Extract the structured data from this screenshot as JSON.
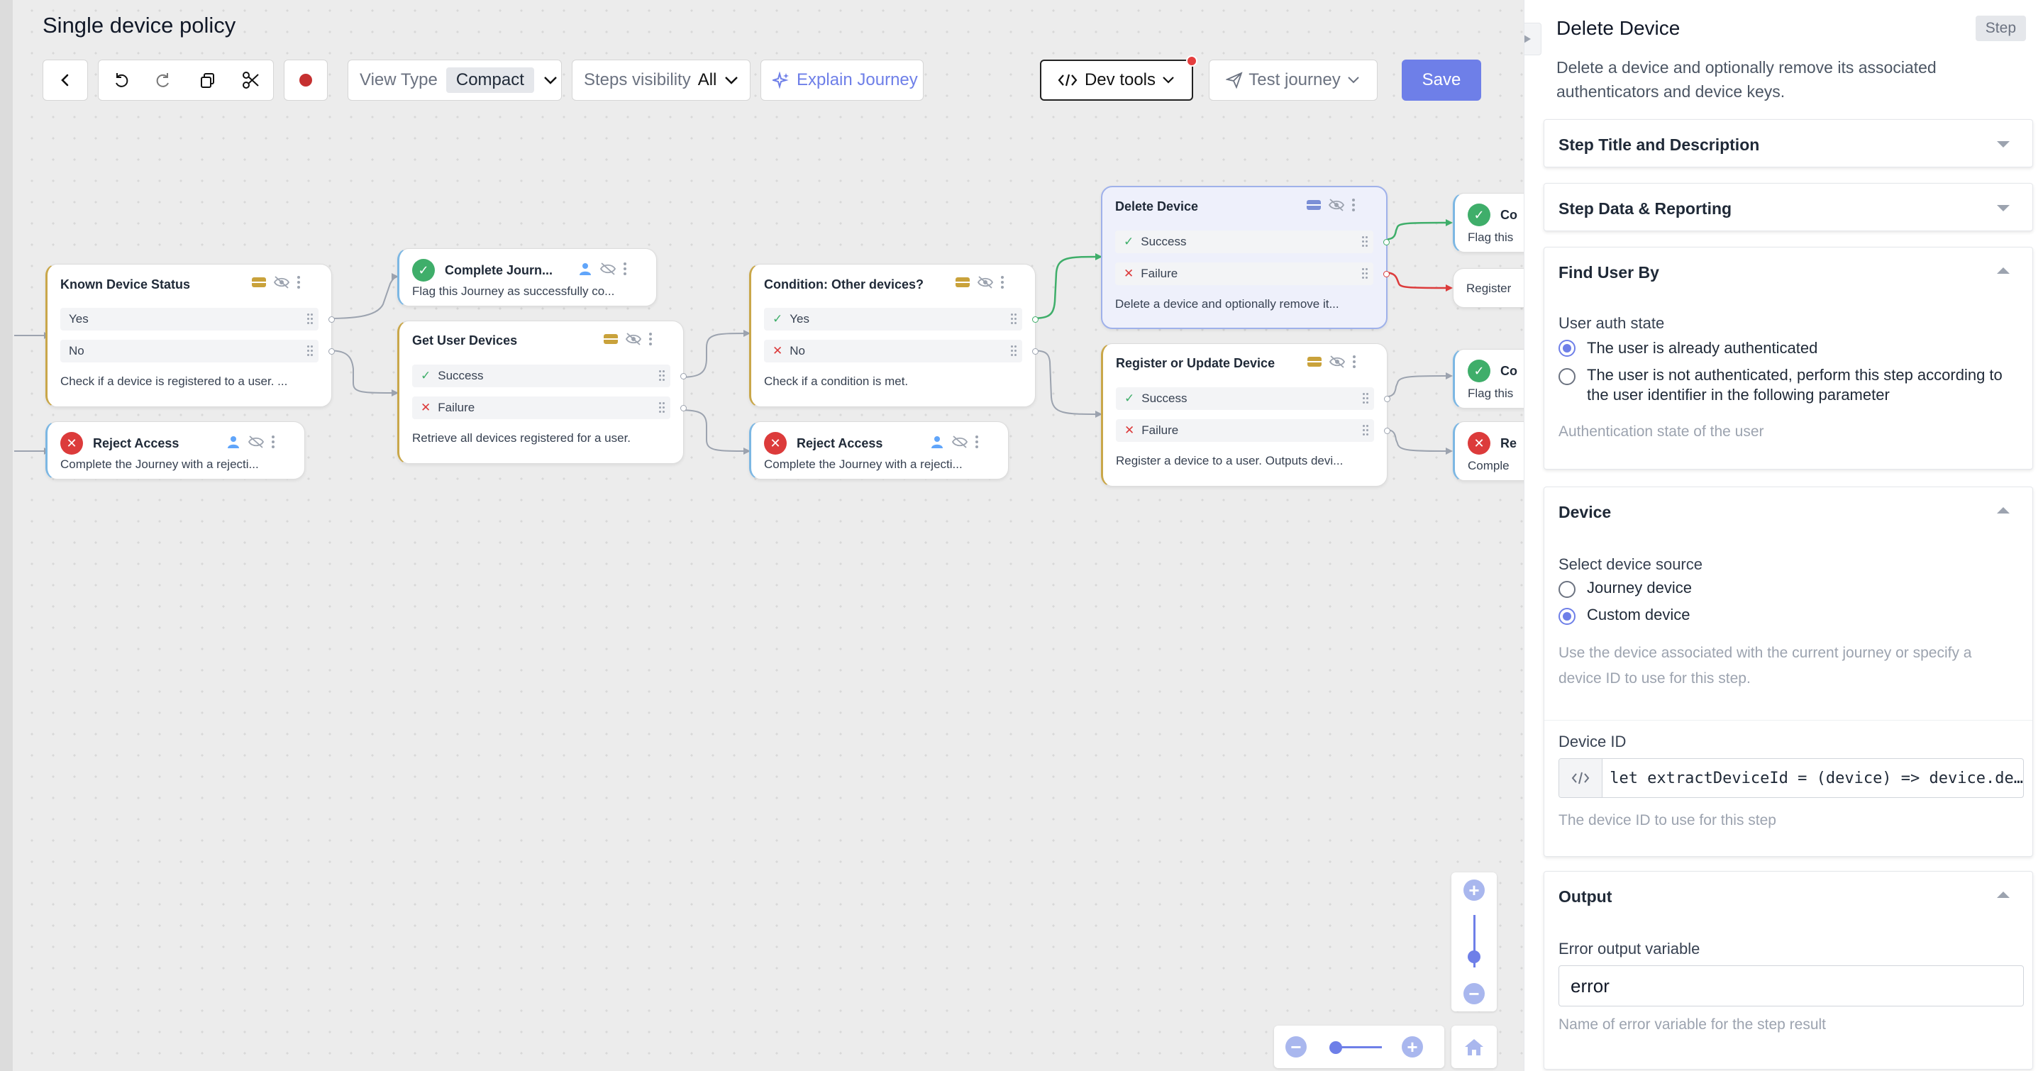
{
  "header": {
    "title": "Single device policy"
  },
  "toolbar": {
    "view_type_label": "View Type",
    "view_type_value": "Compact",
    "steps_visibility_label": "Steps visibility",
    "steps_visibility_value": "All",
    "explain_journey": "Explain Journey",
    "dev_tools": "Dev tools",
    "test_journey": "Test journey",
    "save": "Save"
  },
  "colors": {
    "accent": "#6e7fe8",
    "success": "#3fae6a",
    "failure": "#dc3b3b",
    "branch_node_bar": "#c9a74a",
    "terminal_node_bar": "#7cb7e3"
  },
  "nodes": {
    "known_device": {
      "title": "Known Device Status",
      "out1": "Yes",
      "out2": "No",
      "desc": "Check if a device is registered to a user. ..."
    },
    "reject1": {
      "title": "Reject Access",
      "desc": "Complete the Journey with a rejecti..."
    },
    "complete1": {
      "title": "Complete Journ...",
      "desc": "Flag this Journey as successfully co..."
    },
    "get_devices": {
      "title": "Get User Devices",
      "out1": "Success",
      "out2": "Failure",
      "desc": "Retrieve all devices registered for a user."
    },
    "condition": {
      "title": "Condition: Other devices?",
      "out1": "Yes",
      "out2": "No",
      "desc": "Check if a condition is met."
    },
    "reject2": {
      "title": "Reject Access",
      "desc": "Complete the Journey with a rejecti..."
    },
    "delete_device": {
      "title": "Delete Device",
      "out1": "Success",
      "out2": "Failure",
      "desc": "Delete a device and optionally remove it..."
    },
    "register": {
      "title": "Register or Update Device",
      "out1": "Success",
      "out2": "Failure",
      "desc": "Register a device to a user. Outputs devi..."
    },
    "partial_c1": {
      "title": "Co",
      "desc": "Flag this"
    },
    "partial_reg": {
      "title": "Register"
    },
    "partial_c2": {
      "title": "Co",
      "desc": "Flag this"
    },
    "partial_r": {
      "title": "Re",
      "desc": "Comple"
    }
  },
  "panel": {
    "title": "Delete Device",
    "badge": "Step",
    "description": "Delete a device and optionally remove its associated authenticators and device keys.",
    "sections": {
      "title_desc": "Step Title and Description",
      "data_reporting": "Step Data & Reporting",
      "find_user": "Find User By",
      "device": "Device",
      "output": "Output"
    },
    "find_user": {
      "label": "User auth state",
      "opt1": "The user is already authenticated",
      "opt2": "The user is not authenticated, perform this step according to the user identifier in the following parameter",
      "help": "Authentication state of the user"
    },
    "device": {
      "label": "Select device source",
      "opt1": "Journey device",
      "opt2": "Custom device",
      "help": "Use the device associated with the current journey or specify a device ID to use for this step.",
      "id_label": "Device ID",
      "id_value": "let extractDeviceId = (device) => device.de…",
      "id_help": "The device ID to use for this step"
    },
    "output": {
      "label": "Error output variable",
      "value": "error",
      "help": "Name of error variable for the step result"
    }
  }
}
